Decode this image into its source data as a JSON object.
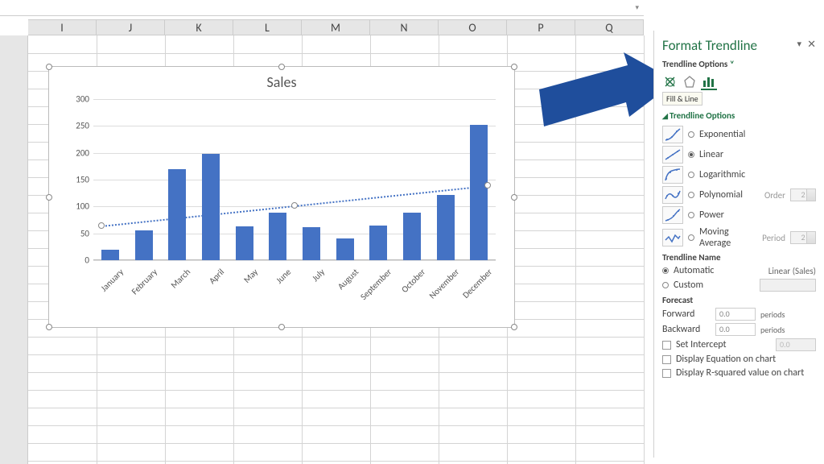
{
  "columns": [
    "I",
    "J",
    "K",
    "L",
    "M",
    "N",
    "O",
    "P",
    "Q"
  ],
  "chart_data": {
    "type": "bar",
    "title": "Sales",
    "categories": [
      "January",
      "February",
      "March",
      "April",
      "May",
      "June",
      "July",
      "August",
      "September",
      "October",
      "November",
      "December"
    ],
    "values": [
      20,
      55,
      170,
      198,
      63,
      88,
      62,
      40,
      65,
      88,
      122,
      252
    ],
    "ylabel": "",
    "xlabel": "",
    "ylim": [
      0,
      300
    ],
    "y_ticks": [
      0,
      50,
      100,
      150,
      200,
      250,
      300
    ],
    "trendline": {
      "type": "Linear",
      "start_y": 65,
      "end_y": 140
    }
  },
  "pane": {
    "title": "Format Trendline",
    "subtitle": "Trendline Options",
    "tooltip": "Fill & Line",
    "section": "Trendline Options",
    "types": [
      {
        "name": "Exponential",
        "checked": false
      },
      {
        "name": "Linear",
        "checked": true
      },
      {
        "name": "Logarithmic",
        "checked": false
      },
      {
        "name": "Polynomial",
        "checked": false,
        "extra_label": "Order",
        "extra_value": "2"
      },
      {
        "name": "Power",
        "checked": false
      },
      {
        "name": "Moving Average",
        "checked": false,
        "extra_label": "Period",
        "extra_value": "2"
      }
    ],
    "name_section": "Trendline Name",
    "name_auto": {
      "label": "Automatic",
      "value": "Linear (Sales)",
      "checked": true
    },
    "name_custom": {
      "label": "Custom",
      "checked": false
    },
    "forecast_section": "Forecast",
    "forecast_forward": {
      "label": "Forward",
      "value": "0.0",
      "units": "periods"
    },
    "forecast_backward": {
      "label": "Backward",
      "value": "0.0",
      "units": "periods"
    },
    "set_intercept": {
      "label": "Set Intercept",
      "value": "0.0"
    },
    "display_eq": "Display Equation on chart",
    "display_r2": "Display R-squared value on chart"
  }
}
